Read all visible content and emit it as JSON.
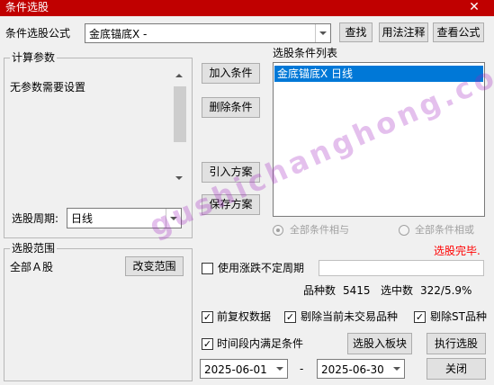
{
  "window": {
    "title": "条件选股",
    "close_glyph": "✕"
  },
  "formula": {
    "label": "条件选股公式",
    "value": "金底锚底X  -",
    "find_button": "查找",
    "usage_button": "用法注释",
    "view_button": "查看公式"
  },
  "params": {
    "legend": "计算参数",
    "empty_text": "无参数需要设置",
    "period_label": "选股周期:",
    "period_value": "日线"
  },
  "actions": {
    "add": "加入条件",
    "remove": "删除条件",
    "import": "引入方案",
    "save": "保存方案"
  },
  "conditions": {
    "label": "选股条件列表",
    "items": [
      "金底锚底X  日线"
    ],
    "logic_and": "全部条件相与",
    "logic_or": "全部条件相或",
    "logic_selected": "and"
  },
  "status": {
    "text": "选股完毕.",
    "color": "#ff0000"
  },
  "scope": {
    "legend": "选股范围",
    "value": "全部Ａ股",
    "change_button": "改变范围"
  },
  "period_change": {
    "label": "使用涨跌不定周期",
    "checked": false
  },
  "stats": {
    "count_label": "品种数",
    "count_value": "5415",
    "selected_label": "选中数",
    "selected_value": "322/5.9%"
  },
  "options": {
    "forward_adjust": "前复权数据",
    "exclude_untraded": "剔除当前未交易品种",
    "exclude_st": "剔除ST品种",
    "period_satisfy": "时间段内满足条件"
  },
  "dates": {
    "from": "2025-06-01",
    "to": "2025-06-30",
    "separator": "-"
  },
  "footer": {
    "to_block": "选股入板块",
    "execute": "执行选股",
    "close": "关闭"
  },
  "watermark": "gushichanghong.com"
}
